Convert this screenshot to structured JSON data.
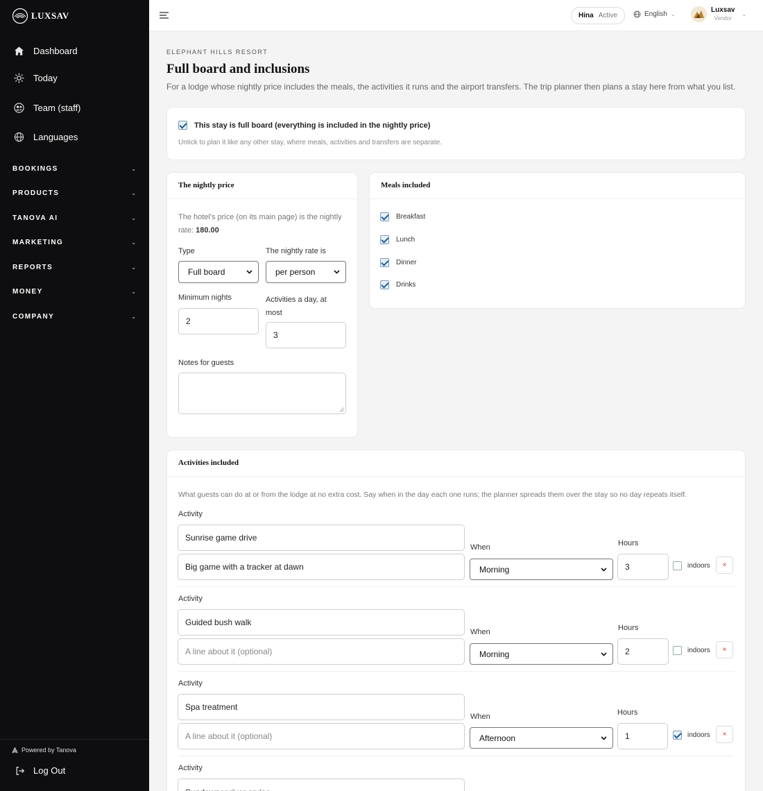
{
  "brand": {
    "name": "LUXSAV"
  },
  "sidebar": {
    "items": [
      {
        "label": "Dashboard",
        "icon": "home-icon"
      },
      {
        "label": "Today",
        "icon": "sun-icon"
      },
      {
        "label": "Team (staff)",
        "icon": "team-icon"
      },
      {
        "label": "Languages",
        "icon": "globe-icon"
      }
    ],
    "sections": [
      "BOOKINGS",
      "PRODUCTS",
      "TANOVA AI",
      "MARKETING",
      "REPORTS",
      "MONEY",
      "COMPANY"
    ],
    "powered_by": "Powered by Tanova",
    "logout": "Log Out"
  },
  "topbar": {
    "status_user": "Hina",
    "status_state": "Active",
    "language": "English",
    "user_name": "Luxsav",
    "user_role": "Vendor"
  },
  "page": {
    "eyebrow": "ELEPHANT HILLS RESORT",
    "title": "Full board and inclusions",
    "description": "For a lodge whose nightly price includes the meals, the activities it runs and the airport transfers. The trip planner then plans a stay here from what you list."
  },
  "full_board": {
    "checked": true,
    "label": "This stay is full board (everything is included in the nightly price)",
    "hint": "Untick to plan it like any other stay, where meals, activities and transfers are separate."
  },
  "nightly": {
    "title": "The nightly price",
    "desc_prefix": "The hotel's price (on its main page) is the nightly rate: ",
    "rate": "180.00",
    "type_label": "Type",
    "type_value": "Full board",
    "rate_is_label": "The nightly rate is",
    "rate_is_value": "per person",
    "min_nights_label": "Minimum nights",
    "min_nights_value": "2",
    "activities_label_1": "Activities a day, at",
    "activities_label_2": "most",
    "activities_value": "3",
    "notes_label": "Notes for guests",
    "notes_value": ""
  },
  "meals": {
    "title": "Meals included",
    "items": [
      {
        "label": "Breakfast",
        "checked": true
      },
      {
        "label": "Lunch",
        "checked": true
      },
      {
        "label": "Dinner",
        "checked": true
      },
      {
        "label": "Drinks",
        "checked": true
      }
    ]
  },
  "activities": {
    "title": "Activities included",
    "description": "What guests can do at or from the lodge at no extra cost. Say when in the day each one runs; the planner spreads them over the stay so no day repeats itself.",
    "labels": {
      "activity": "Activity",
      "when": "When",
      "hours": "Hours",
      "indoors": "indoors",
      "remove": "×"
    },
    "placeholder": "A line about it (optional)",
    "items": [
      {
        "name": "Sunrise game drive",
        "about": "Big game with a tracker at dawn",
        "when": "Morning",
        "hours": "3",
        "indoors": false
      },
      {
        "name": "Guided bush walk",
        "about": "",
        "when": "Morning",
        "hours": "2",
        "indoors": false
      },
      {
        "name": "Spa treatment",
        "about": "",
        "when": "Afternoon",
        "hours": "1",
        "indoors": true
      },
      {
        "name": "Sundowner river cruise",
        "about": "",
        "when": "",
        "hours": "",
        "indoors": false
      }
    ]
  }
}
